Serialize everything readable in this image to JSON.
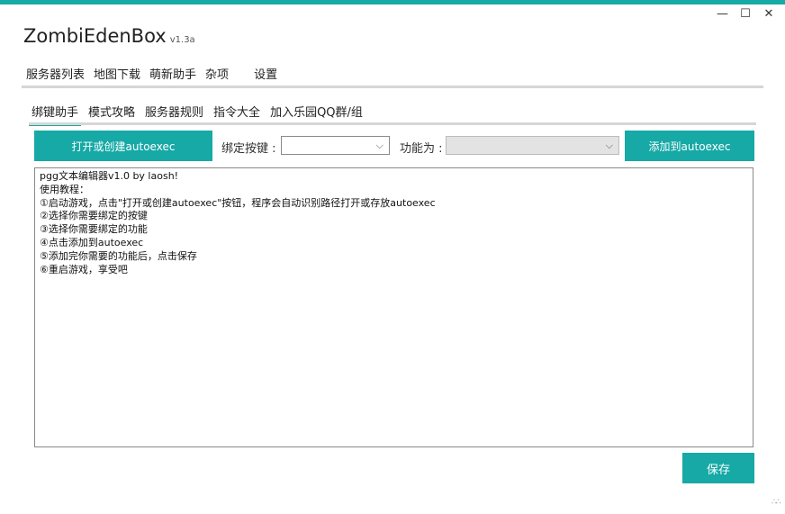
{
  "window": {
    "title": "ZombiEdenBox",
    "version": "v1.3a",
    "minimize_glyph": "—",
    "maximize_glyph": "☐",
    "close_glyph": "✕"
  },
  "main_tabs": [
    {
      "label": "服务器列表"
    },
    {
      "label": "地图下载"
    },
    {
      "label": "萌新助手",
      "active": true
    },
    {
      "label": "杂项"
    },
    {
      "label": "设置"
    }
  ],
  "sub_tabs": [
    {
      "label": "绑键助手",
      "active": true
    },
    {
      "label": "模式攻略"
    },
    {
      "label": "服务器规则"
    },
    {
      "label": "指令大全"
    },
    {
      "label": "加入乐园QQ群/组"
    }
  ],
  "toolbar": {
    "open_button": "打开或创建autoexec",
    "bind_key_label": "绑定按键 :",
    "bind_key_value": "",
    "function_label": "功能为 :",
    "function_value": "",
    "add_button": "添加到autoexec"
  },
  "editor": {
    "lines": [
      "pgg文本编辑器v1.0 by laosh!",
      "使用教程：",
      "①启动游戏，点击\"打开或创建autoexec\"按钮，程序会自动识别路径打开或存放autoexec",
      "②选择你需要绑定的按键",
      "③选择你需要绑定的功能",
      "④点击添加到autoexec",
      "⑤添加完你需要的功能后，点击保存",
      "⑥重启游戏，享受吧"
    ]
  },
  "save_button": "保存",
  "colors": {
    "accent": "#16a9a6"
  }
}
